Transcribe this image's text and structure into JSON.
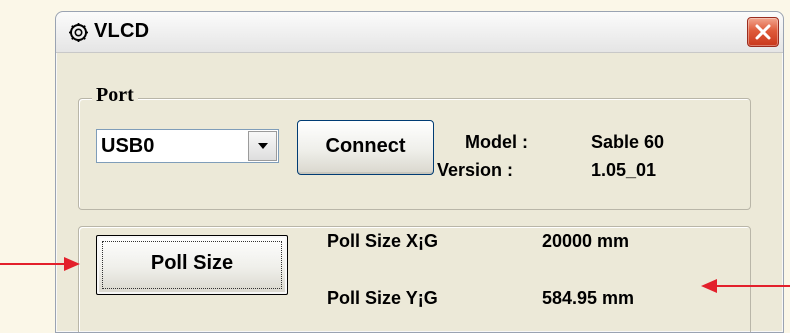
{
  "window": {
    "title": "VLCD",
    "icon": "gear-icon",
    "close_icon": "close-icon"
  },
  "port_group": {
    "label": "Port",
    "combo_value": "USB0",
    "combo_icon": "chevron-down-icon",
    "connect_label": "Connect",
    "model_label": "Model :",
    "model_value": "Sable 60",
    "version_label": "Version :",
    "version_value": "1.05_01"
  },
  "poll_group": {
    "button_label": "Poll Size",
    "x_label": "Poll Size X¡G",
    "x_value": "20000 mm",
    "y_label": "Poll Size Y¡G",
    "y_value": "584.95 mm"
  },
  "annotations": {
    "arrow_color": "#e3202b",
    "left_arrow_icon": "arrow-right-icon",
    "right_arrow_icon": "arrow-left-icon"
  },
  "colors": {
    "window_bg": "#ece9d8",
    "titlebar_bg": "#f3f3f3",
    "close_button": "#df5b3a",
    "page_bg": "#fbf7e8"
  }
}
